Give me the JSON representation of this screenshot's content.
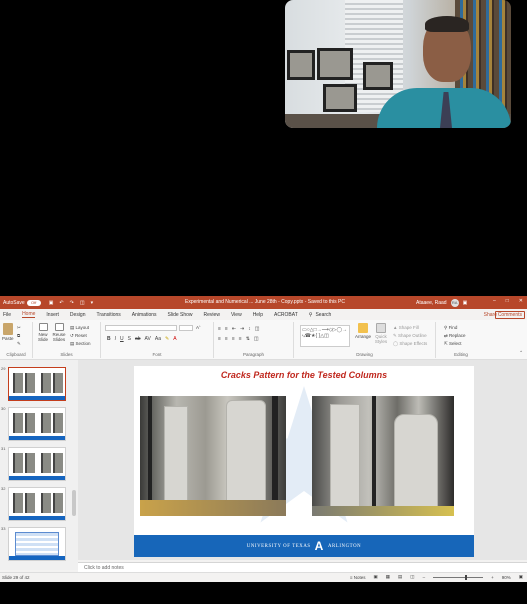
{
  "titlebar": {
    "autosave_label": "AutoSave",
    "autosave_state": "Off",
    "document_title": "Experimental and Numerical ... June 28th  -  Copy.pptx  -  Saved to this PC",
    "user_name": "Ataaee, Raad",
    "user_initials": "RA"
  },
  "tabs": [
    "File",
    "Home",
    "Insert",
    "Design",
    "Transitions",
    "Animations",
    "Slide Show",
    "Review",
    "View",
    "Help",
    "ACROBAT"
  ],
  "active_tab": "Home",
  "search_label": "Search",
  "share_label": "Share",
  "comments_label": "Comments",
  "ribbon": {
    "paste_label": "Paste",
    "layout_label": "Layout",
    "reset_label": "Reset",
    "section_label": "Section",
    "new_slide_label": "New Slide",
    "reuse_slides_label": "Reuse Slides",
    "arrange_label": "Arrange",
    "quick_styles_label": "Quick Styles",
    "shape_fill_label": "Shape Fill",
    "shape_outline_label": "Shape Outline",
    "shape_effects_label": "Shape Effects",
    "find_label": "Find",
    "replace_label": "Replace",
    "select_label": "Select",
    "groups": {
      "clipboard": "Clipboard",
      "slides": "Slides",
      "font": "Font",
      "paragraph": "Paragraph",
      "drawing": "Drawing",
      "editing": "Editing"
    }
  },
  "thumbnails": [
    {
      "number": "29"
    },
    {
      "number": "30"
    },
    {
      "number": "31"
    },
    {
      "number": "32"
    },
    {
      "number": "33"
    }
  ],
  "slide": {
    "title": "Cracks Pattern for the Tested Columns",
    "footer_left": "UNIVERSITY OF TEXAS",
    "footer_right": "ARLINGTON",
    "brand_color": "#1766b9",
    "title_color": "#c0281e"
  },
  "notes_placeholder": "Click to add notes",
  "statusbar": {
    "slide_counter": "Slide 29 of 42",
    "notes_label": "Notes",
    "zoom": "90%"
  }
}
